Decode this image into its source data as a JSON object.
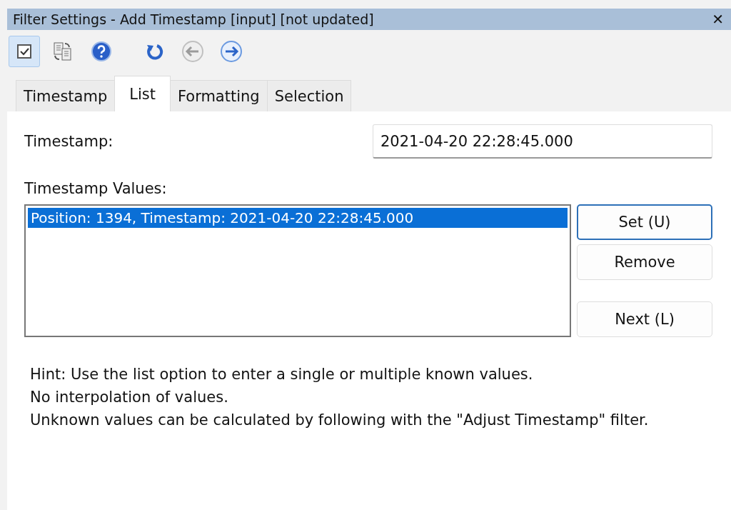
{
  "window": {
    "title": "Filter Settings - Add Timestamp [input] [not updated]",
    "close": "✕"
  },
  "toolbar": [
    {
      "pressed": true,
      "disabled": false
    },
    {
      "pressed": false,
      "disabled": false
    },
    {
      "pressed": false,
      "disabled": false
    },
    {
      "pressed": false,
      "disabled": false
    },
    {
      "pressed": false,
      "disabled": true
    },
    {
      "pressed": false,
      "disabled": false
    }
  ],
  "tabs": [
    {
      "label": "Timestamp",
      "selected": false
    },
    {
      "label": "List",
      "selected": true
    },
    {
      "label": "Formatting",
      "selected": false
    },
    {
      "label": "Selection",
      "selected": false
    }
  ],
  "timestamp": {
    "label": "Timestamp:",
    "value": "2021-04-20 22:28:45.000"
  },
  "values": {
    "label": "Timestamp Values:",
    "items": [
      {
        "text": "Position: 1394, Timestamp: 2021-04-20 22:28:45.000",
        "selected": true
      }
    ]
  },
  "buttons": [
    {
      "label": "Set (U)",
      "default": true
    },
    {
      "label": "Remove",
      "default": false
    },
    {
      "label": "Next (L)",
      "default": false
    }
  ],
  "hint": [
    "Hint: Use the list option to enter a single or multiple known values.",
    "No interpolation of values.",
    "Unknown values can be calculated by following with the \"Adjust Timestamp\" filter."
  ]
}
